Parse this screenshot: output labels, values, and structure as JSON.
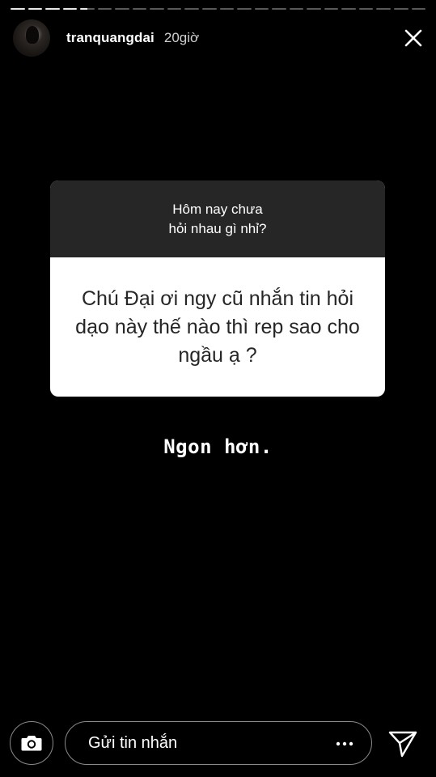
{
  "story": {
    "segments_total": 24,
    "current_segment": 5
  },
  "header": {
    "username": "tranquangdai",
    "time_ago": "20giờ",
    "close_icon": "close-icon"
  },
  "question_card": {
    "prompt": "Hôm nay chưa\nhỏi nhau gì nhỉ?",
    "question": "Chú Đại ơi ngy cũ nhắn tin hỏi dạo này thế nào thì rep sao cho ngầu ạ ?"
  },
  "reply_text": "Ngon hơn.",
  "bottom_bar": {
    "camera_icon": "camera-icon",
    "message_placeholder": "Gửi tin nhắn",
    "more_icon": "more-dots-icon",
    "send_icon": "send-icon"
  }
}
